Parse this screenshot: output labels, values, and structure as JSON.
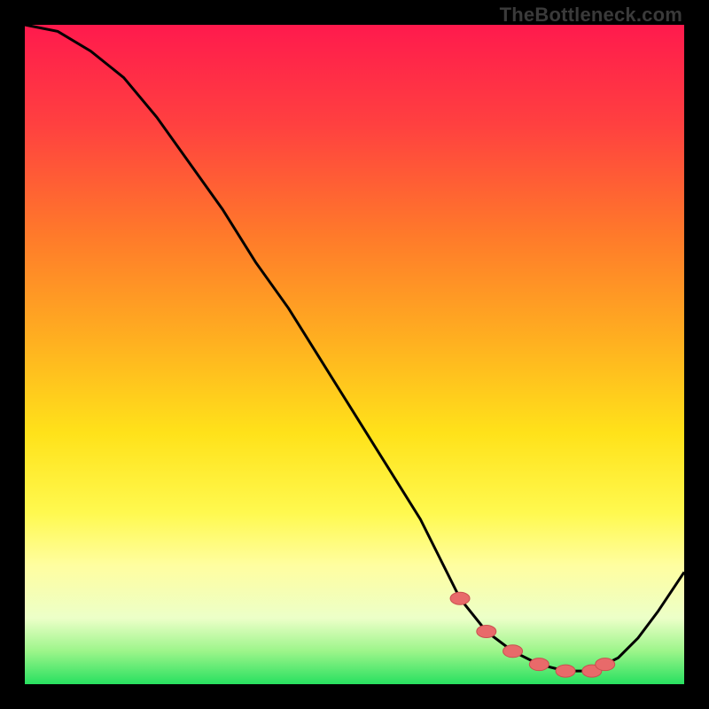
{
  "watermark": "TheBottleneck.com",
  "colors": {
    "frame": "#000000",
    "curve_stroke": "#000000",
    "marker_fill": "#e86a6a",
    "marker_stroke": "#c94f4f"
  },
  "chart_data": {
    "type": "line",
    "title": "",
    "xlabel": "",
    "ylabel": "",
    "xlim": [
      0,
      100
    ],
    "ylim": [
      0,
      100
    ],
    "grid": false,
    "series": [
      {
        "name": "bottleneck-curve",
        "x": [
          0,
          5,
          10,
          15,
          20,
          25,
          30,
          35,
          40,
          45,
          50,
          55,
          60,
          63,
          66,
          70,
          74,
          78,
          82,
          86,
          88,
          90,
          93,
          96,
          100
        ],
        "values": [
          100,
          99,
          96,
          92,
          86,
          79,
          72,
          64,
          57,
          49,
          41,
          33,
          25,
          19,
          13,
          8,
          5,
          3,
          2,
          2,
          3,
          4,
          7,
          11,
          17
        ]
      }
    ],
    "markers": {
      "name": "recommended-range",
      "x": [
        66,
        70,
        74,
        78,
        82,
        86,
        88
      ],
      "values": [
        13,
        8,
        5,
        3,
        2,
        2,
        3
      ]
    }
  }
}
